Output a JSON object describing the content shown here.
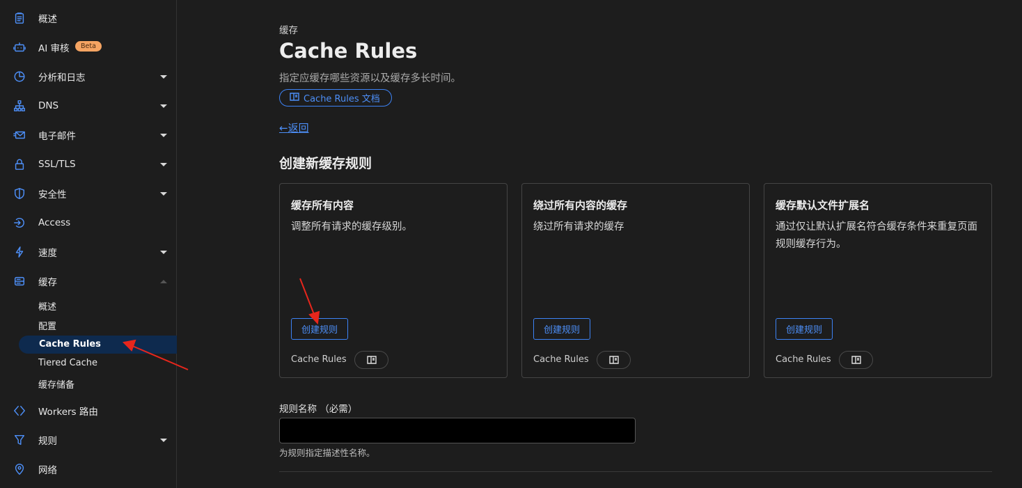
{
  "sidebar": {
    "items": [
      {
        "label": "概述",
        "icon": "clipboard-icon",
        "caret": ""
      },
      {
        "label": "AI 审核",
        "icon": "robot-icon",
        "caret": "",
        "badge": "Beta"
      },
      {
        "label": "分析和日志",
        "icon": "pie-chart-icon",
        "caret": "down"
      },
      {
        "label": "DNS",
        "icon": "network-tree-icon",
        "caret": "down"
      },
      {
        "label": "电子邮件",
        "icon": "mail-icon",
        "caret": "down"
      },
      {
        "label": "SSL/TLS",
        "icon": "lock-icon",
        "caret": "down"
      },
      {
        "label": "安全性",
        "icon": "shield-icon",
        "caret": "down"
      },
      {
        "label": "Access",
        "icon": "access-icon",
        "caret": ""
      },
      {
        "label": "速度",
        "icon": "lightning-icon",
        "caret": "down"
      },
      {
        "label": "缓存",
        "icon": "storage-icon",
        "caret": "up"
      }
    ],
    "cache_subitems": [
      "概述",
      "配置",
      "Cache Rules",
      "Tiered Cache",
      "缓存储备"
    ],
    "bottom_items": [
      {
        "label": "Workers 路由",
        "icon": "workers-icon",
        "caret": ""
      },
      {
        "label": "规则",
        "icon": "rules-icon",
        "caret": "down"
      },
      {
        "label": "网络",
        "icon": "location-pin-icon",
        "caret": ""
      }
    ]
  },
  "header": {
    "breadcrumb": "缓存",
    "title": "Cache Rules",
    "description": "指定应缓存哪些资源以及缓存多长时间。",
    "doc_link": "Cache Rules 文档",
    "back": "返回"
  },
  "section": {
    "title": "创建新缓存规则"
  },
  "cards": [
    {
      "title": "缓存所有内容",
      "description": "调整所有请求的缓存级别。",
      "button": "创建规则",
      "footer": "Cache Rules"
    },
    {
      "title": "绕过所有内容的缓存",
      "description": "绕过所有请求的缓存",
      "button": "创建规则",
      "footer": "Cache Rules"
    },
    {
      "title": "缓存默认文件扩展名",
      "description": "通过仅让默认扩展名符合缓存条件来重复页面规则缓存行为。",
      "button": "创建规则",
      "footer": "Cache Rules"
    }
  ],
  "form": {
    "label": "规则名称 （必需）",
    "value": "",
    "hint": "为规则指定描述性名称。"
  },
  "colors": {
    "accent": "#4d8ff8",
    "background": "#1d1d1d",
    "annotation": "#e8261c",
    "beta_badge": "#f5a462"
  }
}
